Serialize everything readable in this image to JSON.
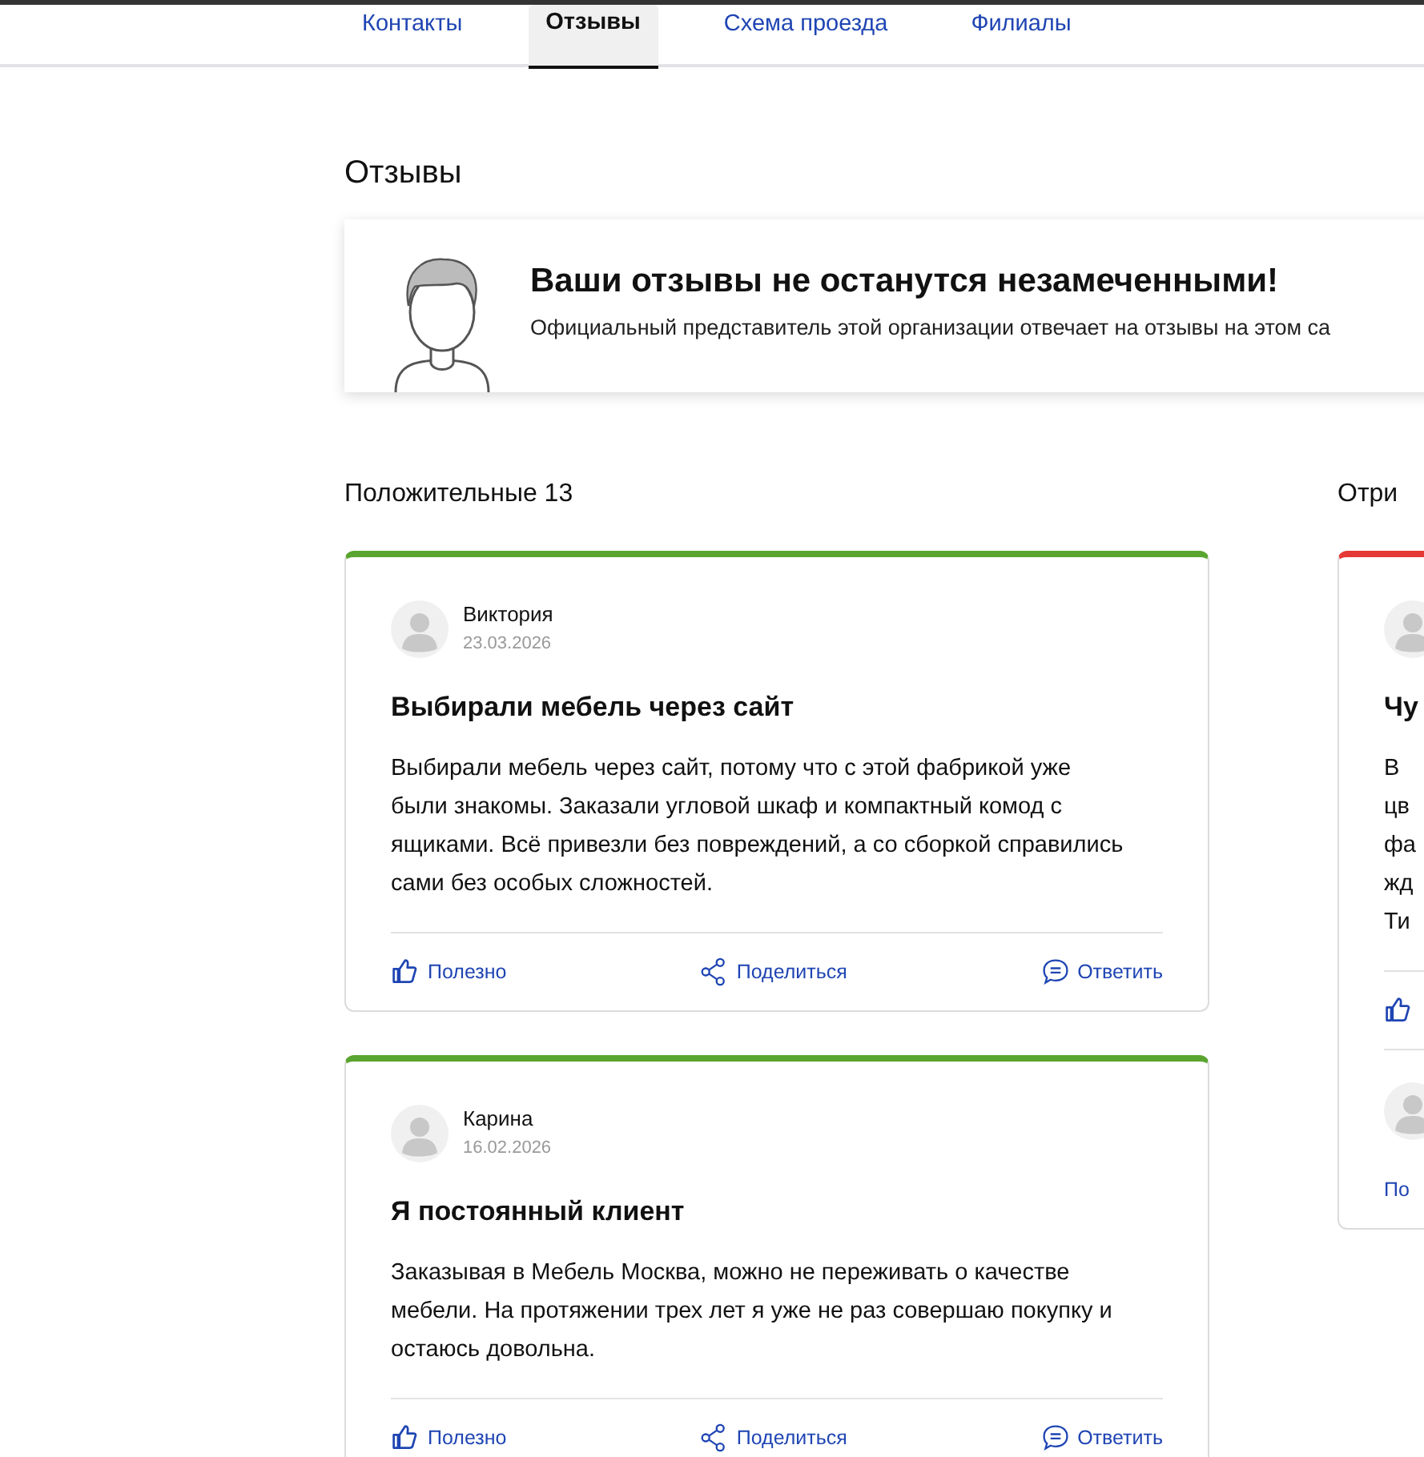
{
  "tabs": [
    {
      "label": "Контакты",
      "selected": false
    },
    {
      "label": "Отзывы",
      "selected": true
    },
    {
      "label": "Схема проезда",
      "selected": false
    },
    {
      "label": "Филиалы",
      "selected": false
    }
  ],
  "heading": "Отзывы",
  "banner": {
    "title": "Ваши отзывы не останутся незамеченными!",
    "text": "Официальный представитель этой организации отвечает на отзывы на этом са"
  },
  "columns": [
    {
      "heading": "Положительные 13",
      "kind": "positive",
      "reviews": [
        {
          "author": "Виктория",
          "date": "23.03.2026",
          "title": "Выбирали мебель через сайт",
          "text": "Выбирали мебель через сайт, потому что с этой фабрикой уже\nбыли знакомы. Заказали угловой шкаф и компактный комод с\nящиками. Всё привезли без повреждений, а со сборкой справились\nсами без особых сложностей.",
          "actions": [
            {
              "kind": "helpful",
              "label": "Полезно"
            },
            {
              "kind": "share",
              "label": "Поделиться"
            },
            {
              "kind": "reply",
              "label": "Ответить"
            }
          ]
        },
        {
          "author": "Карина",
          "date": "16.02.2026",
          "title": "Я постоянный клиент",
          "text": "Заказывая в Мебель Москва, можно не переживать о качестве\nмебели. На протяжении трех лет я уже не раз совершаю покупку и\nостаюсь довольна.",
          "actions": [
            {
              "kind": "helpful",
              "label": "Полезно"
            },
            {
              "kind": "share",
              "label": "Поделиться"
            },
            {
              "kind": "reply",
              "label": "Ответить"
            }
          ]
        }
      ]
    },
    {
      "heading": "Отри",
      "kind": "negative",
      "reviews": [
        {
          "title": "Чу",
          "text": "В\nцв\nфа\nжд\nТи",
          "actions": [
            {
              "kind": "helpful"
            }
          ],
          "reply": {
            "link": "По"
          }
        }
      ]
    }
  ]
}
